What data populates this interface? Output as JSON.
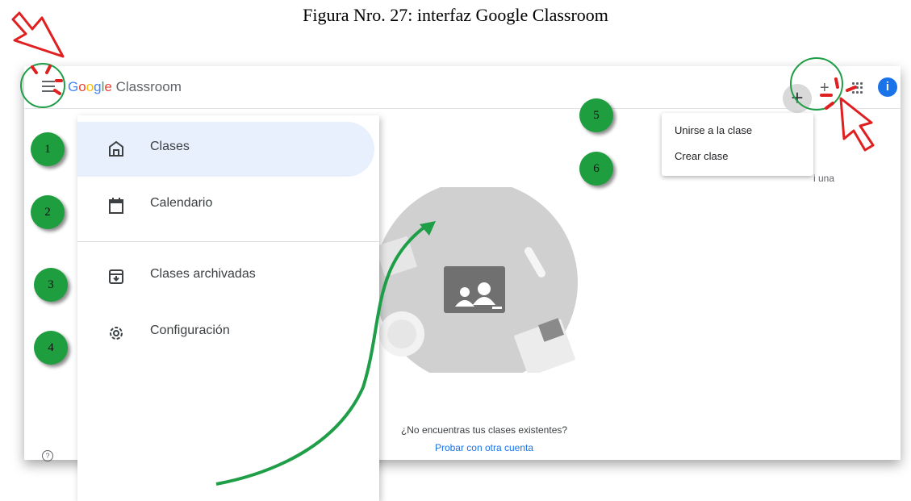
{
  "caption": "Figura Nro. 27: interfaz Google Classroom",
  "header": {
    "logo_google": [
      "G",
      "o",
      "o",
      "g",
      "l",
      "e"
    ],
    "logo_product": "Classroom",
    "plus_symbol": "+",
    "plus_small": "+",
    "avatar_letter": "i",
    "menu_icon": "hamburger-menu-icon",
    "apps_icon": "apps-grid-icon"
  },
  "drawer": {
    "items": [
      {
        "label": "Clases",
        "icon": "home-icon",
        "active": true
      },
      {
        "label": "Calendario",
        "icon": "calendar-icon",
        "active": false
      },
      {
        "label": "Clases archivadas",
        "icon": "archive-icon",
        "active": false
      },
      {
        "label": "Configuración",
        "icon": "settings-gear-icon",
        "active": false
      }
    ]
  },
  "dropdown": {
    "join": "Unirse a la clase",
    "create": "Crear clase"
  },
  "empty_state": {
    "question": "¿No encuentras tus clases existentes?",
    "link": "Probar con otra cuenta",
    "partial": "i una"
  },
  "badges": [
    "1",
    "2",
    "3",
    "4",
    "5",
    "6"
  ],
  "help_symbol": "?",
  "colors": {
    "badge_green": "#1f9e3f",
    "annotation_red": "#e02020",
    "annotation_green": "#1e9e47",
    "active_nav_bg": "#e8f0fe",
    "brand_blue": "#1a73e8"
  }
}
